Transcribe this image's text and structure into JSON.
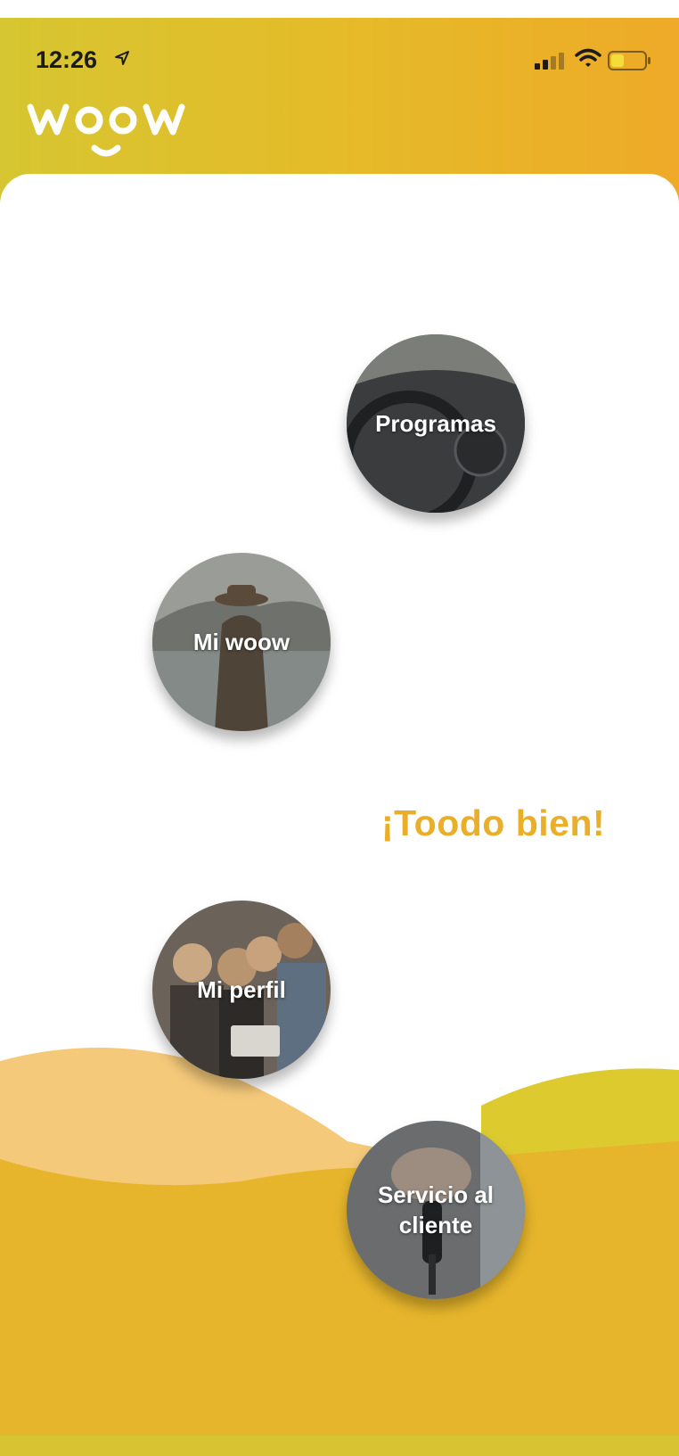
{
  "status_bar": {
    "time": "12:26",
    "icons": [
      "location-arrow-icon",
      "signal-icon",
      "wifi-icon",
      "battery-icon"
    ]
  },
  "header": {
    "logo_text": "woow",
    "gradient": [
      "#d6c631",
      "#eeaa28"
    ]
  },
  "menu": {
    "items": [
      {
        "label": "Programas",
        "image": "car-dashboard-photo"
      },
      {
        "label": "Mi woow",
        "image": "traveler-photo"
      },
      {
        "label": "Mi perfil",
        "image": "friends-photo"
      },
      {
        "label": "Servicio al\ncliente",
        "image": "car-keys-photo"
      }
    ]
  },
  "tagline": "¡Toodo bien!",
  "colors": {
    "accent": "#e9ae2a",
    "wave_dark": "#e6b52b",
    "wave_light": "#f4c97a",
    "wave_lime": "#dcca2f"
  }
}
